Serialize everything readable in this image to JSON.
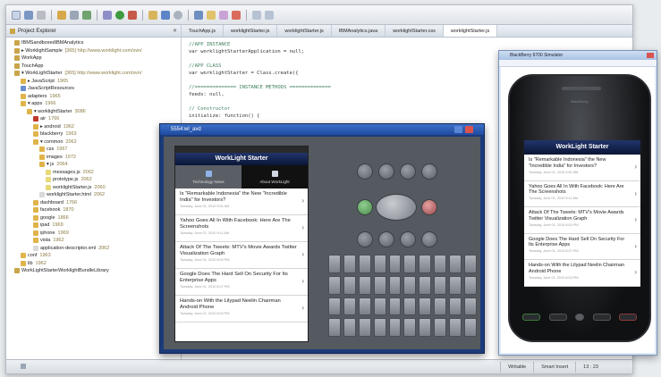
{
  "explorer": {
    "title": "Project Explorer",
    "tree": [
      {
        "label": "IBMSandboxedIBMAnalytics",
        "indent": 1,
        "color": "#c9a54a",
        "sub": ""
      },
      {
        "label": "▸ WorklightSample",
        "indent": 1,
        "color": "#c9a54a",
        "sub": "[365] http://www.worklight.com/svn/"
      },
      {
        "label": "WorkApp",
        "indent": 1,
        "color": "#c9a54a",
        "sub": ""
      },
      {
        "label": "TouchApp",
        "indent": 1,
        "color": "#c9a54a",
        "sub": ""
      },
      {
        "label": "▾ WorkLightStarter",
        "indent": 1,
        "color": "#c9a54a",
        "sub": "[365] http://www.worklight.com/svn/"
      },
      {
        "label": "▸ JavaScript",
        "indent": 2,
        "color": "#e0b44a",
        "sub": "1965"
      },
      {
        "label": "JavaScriptResources",
        "indent": 2,
        "color": "#6b8ecf",
        "sub": ""
      },
      {
        "label": "adapters",
        "indent": 2,
        "color": "#e0b44a",
        "sub": "1965"
      },
      {
        "label": "▾ apps",
        "indent": 2,
        "color": "#e0b44a",
        "sub": "1966"
      },
      {
        "label": "▾ worklightStarter",
        "indent": 3,
        "color": "#e0b44a",
        "sub": "3086"
      },
      {
        "label": "air",
        "indent": 4,
        "color": "#c0392b",
        "sub": "1766"
      },
      {
        "label": "▸ android",
        "indent": 4,
        "color": "#e0b44a",
        "sub": "1962"
      },
      {
        "label": "blackberry",
        "indent": 4,
        "color": "#e0b44a",
        "sub": "1963"
      },
      {
        "label": "▾ common",
        "indent": 4,
        "color": "#e0b44a",
        "sub": "2062"
      },
      {
        "label": "css",
        "indent": 5,
        "color": "#e0b44a",
        "sub": "1967"
      },
      {
        "label": "images",
        "indent": 5,
        "color": "#e0b44a",
        "sub": "1972"
      },
      {
        "label": "▾ js",
        "indent": 5,
        "color": "#e0b44a",
        "sub": "2064"
      },
      {
        "label": "messages.js",
        "indent": 6,
        "color": "#e8d87a",
        "sub": "2062"
      },
      {
        "label": "prototype.js",
        "indent": 6,
        "color": "#e8d87a",
        "sub": "2062"
      },
      {
        "label": "worklightStarter.js",
        "indent": 6,
        "color": "#e8d87a",
        "sub": "2060"
      },
      {
        "label": "worklightStarter.html",
        "indent": 5,
        "color": "#d9d9d9",
        "sub": "2062"
      },
      {
        "label": "dashboard",
        "indent": 4,
        "color": "#e0b44a",
        "sub": "1766"
      },
      {
        "label": "facebook",
        "indent": 4,
        "color": "#e0b44a",
        "sub": "1870"
      },
      {
        "label": "google",
        "indent": 4,
        "color": "#e0b44a",
        "sub": "1866"
      },
      {
        "label": "ipad",
        "indent": 4,
        "color": "#e0b44a",
        "sub": "1969"
      },
      {
        "label": "iphone",
        "indent": 4,
        "color": "#e0b44a",
        "sub": "1969"
      },
      {
        "label": "vista",
        "indent": 4,
        "color": "#e0b44a",
        "sub": "1962"
      },
      {
        "label": "application-descriptor.xml",
        "indent": 4,
        "color": "#d9d9d9",
        "sub": "2062"
      },
      {
        "label": "conf",
        "indent": 2,
        "color": "#e0b44a",
        "sub": "1963"
      },
      {
        "label": "lib",
        "indent": 2,
        "color": "#e0b44a",
        "sub": "1962"
      },
      {
        "label": "WorkLightStarterWorklightBundleLibrary",
        "indent": 1,
        "color": "#c9a54a",
        "sub": ""
      }
    ]
  },
  "editor": {
    "tabs": [
      "TouchApp.js",
      "worklightStarter.js",
      "worklightStarter.js",
      "IBMAnalytics.java",
      "worklightStarter.css",
      "worklightStarter.js"
    ],
    "active_tab": 5,
    "code": [
      {
        "t": "//APP INSTANCE",
        "k": "comment"
      },
      {
        "t": "var worklightStarterApplication = null;",
        "k": "code"
      },
      {
        "t": "",
        "k": "code"
      },
      {
        "t": "//APP CLASS",
        "k": "comment"
      },
      {
        "t": "var worklightStarter = Class.create({",
        "k": "code"
      },
      {
        "t": "",
        "k": "code"
      },
      {
        "t": "  //============== INSTANCE METHODS ==============",
        "k": "comment"
      },
      {
        "t": "    feeds: null,",
        "k": "code"
      },
      {
        "t": "",
        "k": "code"
      },
      {
        "t": "    // Constructor",
        "k": "comment"
      },
      {
        "t": "    initialize: function() {",
        "k": "code"
      }
    ]
  },
  "status": {
    "writable": "Writable",
    "insert": "Smart Insert",
    "position": "13 : 23"
  },
  "emulator": {
    "title": "5554:wl_avd",
    "app": {
      "header": "WorkLight Starter",
      "tabs": [
        "Technology News",
        "About WorkLight"
      ],
      "news": [
        {
          "title": "Is \"Remarkable Indonesia\" the New \"Incredible India\" for Investors?",
          "meta": "Tuesday, June 01, 2010 9:51 AM"
        },
        {
          "title": "Yahoo Goes All In With Facebook: Here Are The Screenshots",
          "meta": "Tuesday, June 01, 2010 9:11 AM"
        },
        {
          "title": "Attack Of The Tweets: MTV's Movie Awards Twitter Visualization Graph",
          "meta": "Tuesday, June 01, 2010 8:53 PM"
        },
        {
          "title": "Google Does The Hard Sell On Security For Its Enterprise Apps",
          "meta": "Tuesday, June 01, 2010 8:27 PM"
        },
        {
          "title": "Hands-on With the Lilypad Neelin Chairman Android Phone",
          "meta": "Tuesday, June 01, 2010 8:03 PM"
        }
      ]
    }
  },
  "blackberry": {
    "title": "BlackBerry 9700 Simulator",
    "brand": "BlackBerry",
    "app": {
      "header": "WorkLight Starter",
      "news": [
        {
          "title": "Is \"Remarkable Indonesia\" the New \"Incredible India\" for Investors?",
          "meta": "Tuesday, June 01, 2010 9:51 AM"
        },
        {
          "title": "Yahoo Goes All In With Facebook: Here Are The Screenshots",
          "meta": "Tuesday, June 01, 2010 9:11 AM"
        },
        {
          "title": "Attack Of The Tweets: MTV's Movie Awards Twitter Visualization Graph",
          "meta": "Tuesday, June 01, 2010 8:53 PM"
        },
        {
          "title": "Google Does The Hard Sell On Security For Its Enterprise Apps",
          "meta": "Tuesday, June 01, 2010 8:27 PM"
        },
        {
          "title": "Hands-on With the Lilypad Neelin Chairman Android Phone",
          "meta": "Tuesday, June 01, 2010 8:03 PM"
        }
      ]
    }
  },
  "colors": {
    "app_header": "#0a1636",
    "emulator_frame": "#1b3b7a",
    "ide_background": "#ffffff"
  }
}
